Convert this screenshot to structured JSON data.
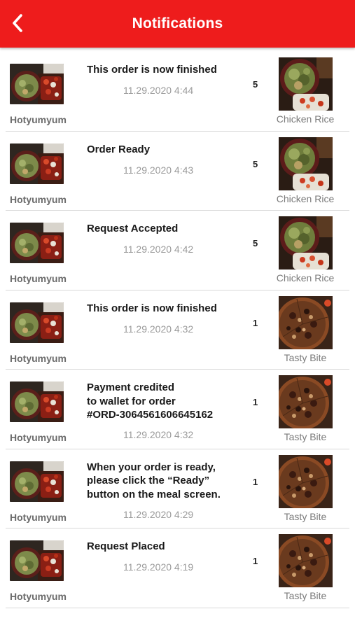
{
  "header": {
    "title": "Notifications",
    "background": "#ee1c1c",
    "back_icon": "chevron-left-icon"
  },
  "notifications": [
    {
      "seller": "Hotyumyum",
      "message": "This order is now finished",
      "time": "11.29.2020 4:44",
      "quantity": "5",
      "dish_name": "Chicken Rice",
      "dish_image": "chicken-rice"
    },
    {
      "seller": "Hotyumyum",
      "message": "Order Ready",
      "time": "11.29.2020 4:43",
      "quantity": "5",
      "dish_name": "Chicken Rice",
      "dish_image": "chicken-rice"
    },
    {
      "seller": "Hotyumyum",
      "message": "Request Accepted",
      "time": "11.29.2020 4:42",
      "quantity": "5",
      "dish_name": "Chicken Rice",
      "dish_image": "chicken-rice"
    },
    {
      "seller": "Hotyumyum",
      "message": "This order is now finished",
      "time": "11.29.2020 4:32",
      "quantity": "1",
      "dish_name": "Tasty Bite",
      "dish_image": "pizza"
    },
    {
      "seller": "Hotyumyum",
      "message": "Payment credited\nto wallet for order\n#ORD-3064561606645162",
      "time": "11.29.2020 4:32",
      "quantity": "1",
      "dish_name": "Tasty Bite",
      "dish_image": "pizza"
    },
    {
      "seller": "Hotyumyum",
      "message": "When your order is ready,\nplease click the “Ready”\nbutton on the meal screen.",
      "time": "11.29.2020 4:29",
      "quantity": "1",
      "dish_name": "Tasty Bite",
      "dish_image": "pizza"
    },
    {
      "seller": "Hotyumyum",
      "message": "Request Placed",
      "time": "11.29.2020 4:19",
      "quantity": "1",
      "dish_name": "Tasty Bite",
      "dish_image": "pizza"
    }
  ]
}
